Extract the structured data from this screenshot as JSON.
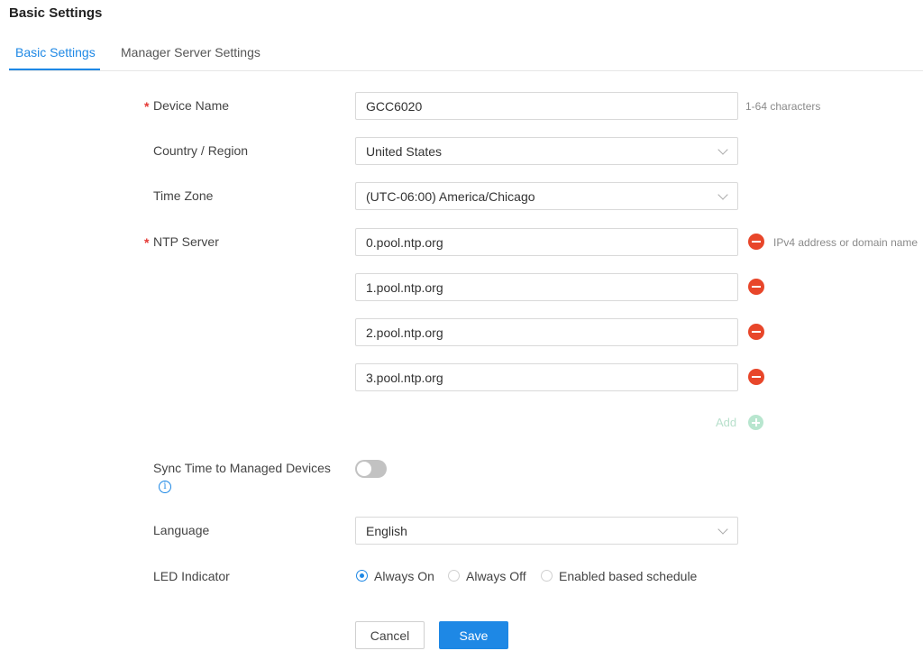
{
  "page": {
    "title": "Basic Settings"
  },
  "tabs": [
    {
      "label": "Basic Settings",
      "active": true
    },
    {
      "label": "Manager Server Settings",
      "active": false
    }
  ],
  "required_mark": "*",
  "device_name": {
    "label": "Device Name",
    "value": "GCC6020",
    "hint": "1-64 characters"
  },
  "country_region": {
    "label": "Country / Region",
    "value": "United States"
  },
  "time_zone": {
    "label": "Time Zone",
    "value": "(UTC-06:00) America/Chicago"
  },
  "ntp_server": {
    "label": "NTP Server",
    "hint": "IPv4 address or domain name",
    "servers": [
      "0.pool.ntp.org",
      "1.pool.ntp.org",
      "2.pool.ntp.org",
      "3.pool.ntp.org"
    ],
    "add_label": "Add"
  },
  "sync_time": {
    "label": "Sync Time to Managed Devices",
    "enabled": false,
    "info_glyph": "i"
  },
  "language": {
    "label": "Language",
    "value": "English"
  },
  "led_indicator": {
    "label": "LED Indicator",
    "options": [
      {
        "label": "Always On",
        "checked": true
      },
      {
        "label": "Always Off",
        "checked": false
      },
      {
        "label": "Enabled based schedule",
        "checked": false
      }
    ]
  },
  "actions": {
    "cancel_label": "Cancel",
    "save_label": "Save"
  },
  "colors": {
    "accent": "#1e88e5",
    "danger": "#e8462a",
    "add": "#b8e6cf",
    "required": "#e53935"
  }
}
